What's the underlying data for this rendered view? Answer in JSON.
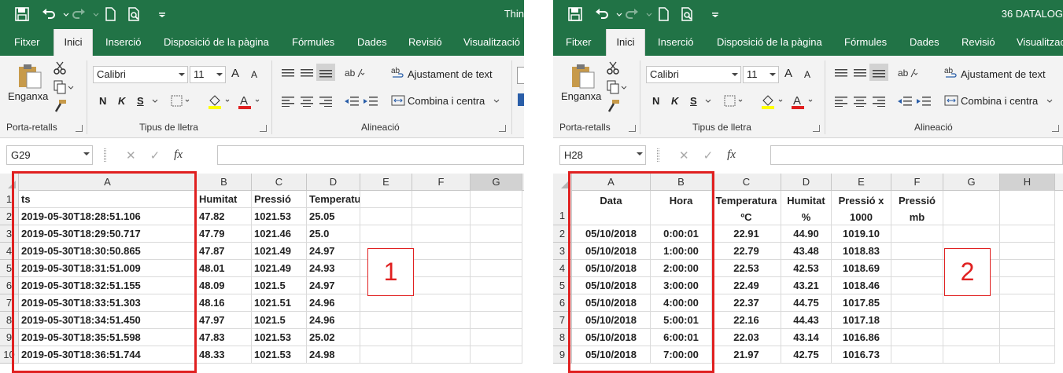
{
  "panels": [
    {
      "title": "Thin",
      "tabs": [
        "Fitxer",
        "Inici",
        "Inserció",
        "Disposició de la pàgina",
        "Fórmules",
        "Dades",
        "Revisió",
        "Visualització"
      ],
      "ribbon": {
        "paste_label": "Enganxa",
        "font_name": "Calibri",
        "font_size": "11",
        "grow_font": "A",
        "shrink_font": "A",
        "bold": "N",
        "italic": "K",
        "underline": "S",
        "wrap_text": "Ajustament de text",
        "merge_center": "Combina i centra",
        "group_clipboard": "Porta-retalls",
        "group_font": "Tipus de lletra",
        "group_alignment": "Alineació"
      },
      "name_box": "G29",
      "fx": "fx",
      "columns": [
        "A",
        "B",
        "C",
        "D",
        "E",
        "F",
        "G"
      ],
      "rows": [
        {
          "num": "1",
          "cells": [
            "ts",
            "Humitat",
            "Pressió",
            "Temperatura",
            "",
            "",
            ""
          ]
        },
        {
          "num": "2",
          "cells": [
            "2019-05-30T18:28:51.106",
            "47.82",
            "1021.53",
            "25.05",
            "",
            "",
            ""
          ]
        },
        {
          "num": "3",
          "cells": [
            "2019-05-30T18:29:50.717",
            "47.79",
            "1021.46",
            "25.0",
            "",
            "",
            ""
          ]
        },
        {
          "num": "4",
          "cells": [
            "2019-05-30T18:30:50.865",
            "47.87",
            "1021.49",
            "24.97",
            "",
            "",
            ""
          ]
        },
        {
          "num": "5",
          "cells": [
            "2019-05-30T18:31:51.009",
            "48.01",
            "1021.49",
            "24.93",
            "",
            "",
            ""
          ]
        },
        {
          "num": "6",
          "cells": [
            "2019-05-30T18:32:51.155",
            "48.09",
            "1021.5",
            "24.97",
            "",
            "",
            ""
          ]
        },
        {
          "num": "7",
          "cells": [
            "2019-05-30T18:33:51.303",
            "48.16",
            "1021.51",
            "24.96",
            "",
            "",
            ""
          ]
        },
        {
          "num": "8",
          "cells": [
            "2019-05-30T18:34:51.450",
            "47.97",
            "1021.5",
            "24.96",
            "",
            "",
            ""
          ]
        },
        {
          "num": "9",
          "cells": [
            "2019-05-30T18:35:51.598",
            "47.83",
            "1021.53",
            "25.02",
            "",
            "",
            ""
          ]
        },
        {
          "num": "10",
          "cells": [
            "2019-05-30T18:36:51.744",
            "48.33",
            "1021.53",
            "24.98",
            "",
            "",
            ""
          ]
        }
      ],
      "marker": "1"
    },
    {
      "title": "36 DATALOG",
      "tabs": [
        "Fitxer",
        "Inici",
        "Inserció",
        "Disposició de la pàgina",
        "Fórmules",
        "Dades",
        "Revisió",
        "Visualitzac"
      ],
      "ribbon": {
        "paste_label": "Enganxa",
        "font_name": "Calibri",
        "font_size": "11",
        "grow_font": "A",
        "shrink_font": "A",
        "bold": "N",
        "italic": "K",
        "underline": "S",
        "wrap_text": "Ajustament de text",
        "merge_center": "Combina i centra",
        "group_clipboard": "Porta-retalls",
        "group_font": "Tipus de lletra",
        "group_alignment": "Alineació"
      },
      "name_box": "H28",
      "fx": "fx",
      "columns": [
        "A",
        "B",
        "C",
        "D",
        "E",
        "F",
        "G",
        "H"
      ],
      "header_row": {
        "num": "1",
        "cells": [
          "Data",
          "Hora",
          "Temperatura ºC",
          "Humitat %",
          "Pressió x 1000",
          "Pressió mb",
          "",
          ""
        ]
      },
      "rows": [
        {
          "num": "2",
          "cells": [
            "05/10/2018",
            "0:00:01",
            "22.91",
            "44.90",
            "1019.10",
            "",
            "",
            ""
          ]
        },
        {
          "num": "3",
          "cells": [
            "05/10/2018",
            "1:00:00",
            "22.79",
            "43.48",
            "1018.83",
            "",
            "",
            ""
          ]
        },
        {
          "num": "4",
          "cells": [
            "05/10/2018",
            "2:00:00",
            "22.53",
            "42.53",
            "1018.69",
            "",
            "",
            ""
          ]
        },
        {
          "num": "5",
          "cells": [
            "05/10/2018",
            "3:00:00",
            "22.49",
            "43.21",
            "1018.46",
            "",
            "",
            ""
          ]
        },
        {
          "num": "6",
          "cells": [
            "05/10/2018",
            "4:00:00",
            "22.37",
            "44.75",
            "1017.85",
            "",
            "",
            ""
          ]
        },
        {
          "num": "7",
          "cells": [
            "05/10/2018",
            "5:00:01",
            "22.16",
            "44.43",
            "1017.18",
            "",
            "",
            ""
          ]
        },
        {
          "num": "8",
          "cells": [
            "05/10/2018",
            "6:00:01",
            "22.03",
            "43.14",
            "1016.86",
            "",
            "",
            ""
          ]
        },
        {
          "num": "9",
          "cells": [
            "05/10/2018",
            "7:00:00",
            "21.97",
            "42.75",
            "1016.73",
            "",
            "",
            ""
          ]
        }
      ],
      "marker": "2"
    }
  ]
}
